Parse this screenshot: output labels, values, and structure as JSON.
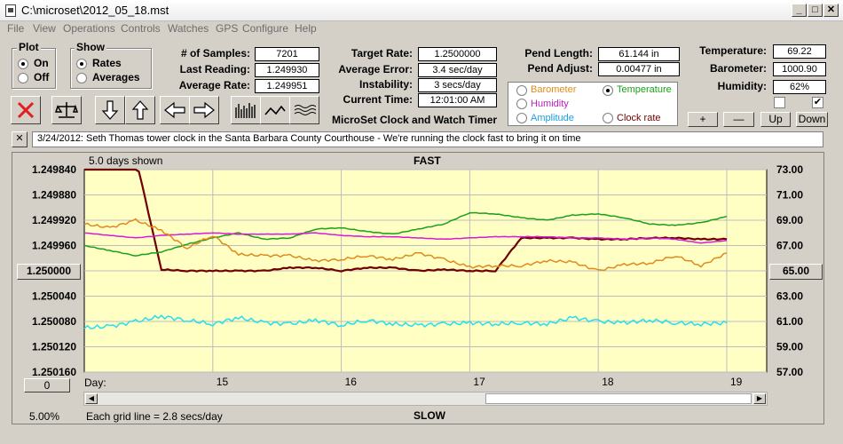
{
  "window": {
    "title": "C:\\microset\\2012_05_18.mst"
  },
  "menu": [
    "File",
    "View",
    "Operations",
    "Controls",
    "Watches",
    "GPS",
    "Configure",
    "Help"
  ],
  "plot_group": {
    "label": "Plot",
    "on": "On",
    "off": "Off"
  },
  "show_group": {
    "label": "Show",
    "rates": "Rates",
    "averages": "Averages"
  },
  "stats": {
    "samples_label": "# of Samples:",
    "samples": "7201",
    "last_reading_label": "Last Reading:",
    "last_reading": "1.249930",
    "average_rate_label": "Average Rate:",
    "average_rate": "1.249951",
    "target_rate_label": "Target Rate:",
    "target_rate": "1.2500000",
    "average_error_label": "Average Error:",
    "average_error": "3.4 sec/day",
    "instability_label": "Instability:",
    "instability": "3 secs/day",
    "current_time_label": "Current Time:",
    "current_time": "12:01:00 AM",
    "pend_length_label": "Pend Length:",
    "pend_length": "61.144 in",
    "pend_adjust_label": "Pend Adjust:",
    "pend_adjust": "0.00477 in",
    "temperature_label": "Temperature:",
    "temperature": "69.22",
    "barometer_label": "Barometer:",
    "barometer": "1000.90",
    "humidity_label": "Humidity:",
    "humidity": "62%"
  },
  "app_title": "MicroSet Clock and Watch Timer",
  "sensor_select": {
    "barometer": "Barometer",
    "temperature": "Temperature",
    "humidity": "Humidity",
    "amplitude": "Amplitude",
    "clock_rate": "Clock rate"
  },
  "small_buttons": {
    "plus": "+",
    "minus": "—",
    "up": "Up",
    "down": "Down"
  },
  "note": {
    "close": "✕",
    "text": "3/24/2012: Seth Thomas tower clock in the Santa Barbara County Courthouse - We're running the clock fast to bring it on time"
  },
  "chart_labels": {
    "days_shown": "5.0 days shown",
    "fast": "FAST",
    "slow": "SLOW",
    "day_label": "Day:",
    "grid_note": "Each grid line = 2.8 secs/day",
    "percent": "5.00%",
    "left_box": "1.250000",
    "right_box": "65.00",
    "bottom_box": "0"
  },
  "colors": {
    "barometer": "#e08a1e",
    "temperature": "#1aa01a",
    "humidity": "#d91ad9",
    "amplitude": "#22e0f0",
    "clock_rate": "#700000",
    "plot_bg": "#ffffc4"
  },
  "chart_data": {
    "type": "line",
    "x": [
      14.0,
      14.2,
      14.4,
      14.6,
      14.8,
      15.0,
      15.2,
      15.4,
      15.6,
      15.8,
      16.0,
      16.2,
      16.4,
      16.6,
      16.8,
      17.0,
      17.2,
      17.4,
      17.6,
      17.8,
      18.0,
      18.2,
      18.4,
      18.6,
      18.8,
      19.0
    ],
    "xticks": [
      "15",
      "16",
      "17",
      "18",
      "19"
    ],
    "yleft_ticks": [
      "1.249840",
      "1.249880",
      "1.249920",
      "1.249960",
      "1.250000",
      "1.250040",
      "1.250080",
      "1.250120",
      "1.250160"
    ],
    "yleft_range": [
      1.24984,
      1.25016
    ],
    "yright_ticks": [
      "73.00",
      "71.00",
      "69.00",
      "67.00",
      "65.00",
      "63.00",
      "61.00",
      "59.00",
      "57.00"
    ],
    "yright_range": [
      57,
      73
    ],
    "series": [
      {
        "name": "Clock rate",
        "axis": "left",
        "values": [
          1.24982,
          1.24982,
          1.24982,
          1.249998,
          1.25,
          1.25,
          1.25,
          1.25,
          1.249995,
          1.249995,
          1.25,
          1.249995,
          1.249995,
          1.25,
          1.249998,
          1.25,
          1.25,
          1.249948,
          1.249948,
          1.249948,
          1.24995,
          1.24995,
          1.249948,
          1.249948,
          1.24995,
          1.24995
        ]
      },
      {
        "name": "Temperature",
        "axis": "right",
        "values": [
          67.0,
          66.6,
          66.2,
          66.5,
          67.1,
          67.6,
          68.0,
          67.5,
          67.6,
          68.3,
          68.4,
          68.1,
          67.9,
          68.3,
          68.7,
          69.6,
          69.5,
          69.2,
          69.0,
          69.4,
          69.5,
          69.2,
          68.7,
          68.6,
          68.8,
          69.3
        ]
      },
      {
        "name": "Humidity",
        "axis": "right",
        "values": [
          68.0,
          67.8,
          67.6,
          67.8,
          67.9,
          68.0,
          67.9,
          67.9,
          67.9,
          68.0,
          67.8,
          67.7,
          67.7,
          67.6,
          67.5,
          67.6,
          67.7,
          67.7,
          67.7,
          67.6,
          67.6,
          67.5,
          67.6,
          67.5,
          67.2,
          67.4
        ]
      },
      {
        "name": "Barometer",
        "axis": "right",
        "values": [
          68.7,
          68.4,
          69.0,
          68.2,
          66.8,
          67.8,
          66.3,
          66.2,
          66.2,
          65.8,
          65.9,
          66.2,
          65.9,
          66.4,
          65.9,
          65.3,
          65.4,
          65.4,
          65.8,
          65.7,
          65.0,
          65.5,
          65.6,
          66.2,
          65.4,
          66.4
        ]
      },
      {
        "name": "Amplitude",
        "axis": "right",
        "values": [
          60.5,
          60.6,
          61.0,
          61.4,
          61.1,
          60.8,
          61.3,
          60.9,
          60.8,
          61.1,
          60.7,
          61.1,
          60.8,
          60.7,
          60.8,
          60.9,
          60.8,
          60.9,
          60.8,
          61.3,
          61.0,
          60.9,
          61.1,
          60.9,
          60.8,
          60.9
        ]
      }
    ]
  }
}
